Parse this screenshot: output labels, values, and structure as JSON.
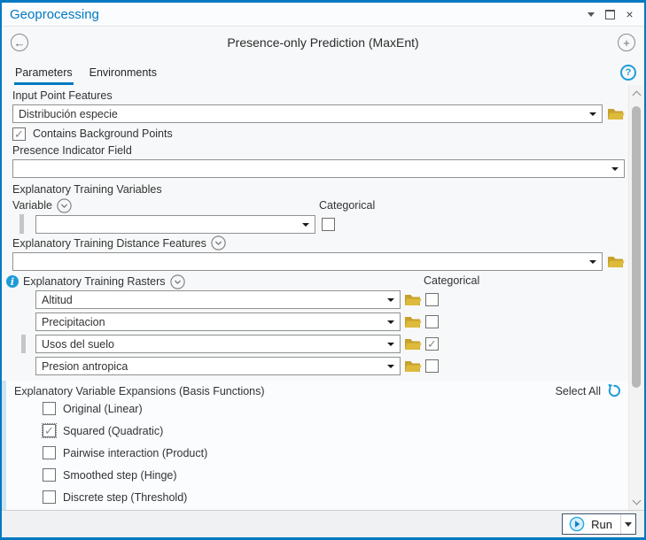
{
  "window": {
    "title": "Geoprocessing"
  },
  "tool": {
    "title": "Presence-only Prediction (MaxEnt)"
  },
  "tabs": {
    "parameters": "Parameters",
    "environments": "Environments"
  },
  "form": {
    "input_point_features": {
      "label": "Input Point Features",
      "value": "Distribución especie"
    },
    "contains_background_points": {
      "label": "Contains Background Points",
      "checked": true
    },
    "presence_indicator_field": {
      "label": "Presence Indicator Field",
      "value": ""
    },
    "training_variables": {
      "label": "Explanatory Training Variables",
      "variable_column": "Variable",
      "categorical_column": "Categorical",
      "rows": [
        {
          "value": "",
          "categorical": false,
          "active": true
        }
      ]
    },
    "training_distance_features": {
      "label": "Explanatory Training Distance Features",
      "value": ""
    },
    "training_rasters": {
      "label": "Explanatory Training Rasters",
      "categorical_column": "Categorical",
      "rows": [
        {
          "value": "Altitud",
          "categorical": false,
          "active": false
        },
        {
          "value": "Precipitacion",
          "categorical": false,
          "active": false
        },
        {
          "value": "Usos del suelo",
          "categorical": true,
          "active": true
        },
        {
          "value": "Presion antropica",
          "categorical": false,
          "active": false
        }
      ]
    },
    "basis_functions": {
      "label": "Explanatory Variable Expansions (Basis Functions)",
      "select_all_label": "Select All",
      "options": [
        {
          "label": "Original (Linear)",
          "checked": false,
          "focused": false
        },
        {
          "label": "Squared (Quadratic)",
          "checked": true,
          "focused": true
        },
        {
          "label": "Pairwise interaction (Product)",
          "checked": false,
          "focused": false
        },
        {
          "label": "Smoothed step (Hinge)",
          "checked": false,
          "focused": false
        },
        {
          "label": "Discrete step (Threshold)",
          "checked": false,
          "focused": false
        }
      ]
    }
  },
  "footer": {
    "run_label": "Run"
  },
  "colors": {
    "accent_blue": "#0079c1",
    "icon_blue": "#1e9cd7",
    "folder_gold": "#d9b430",
    "section_bar": "#cfe3f2"
  },
  "icons": {
    "back": "←",
    "add": "+",
    "help": "?",
    "close": "×",
    "info": "i",
    "check": "✓"
  }
}
